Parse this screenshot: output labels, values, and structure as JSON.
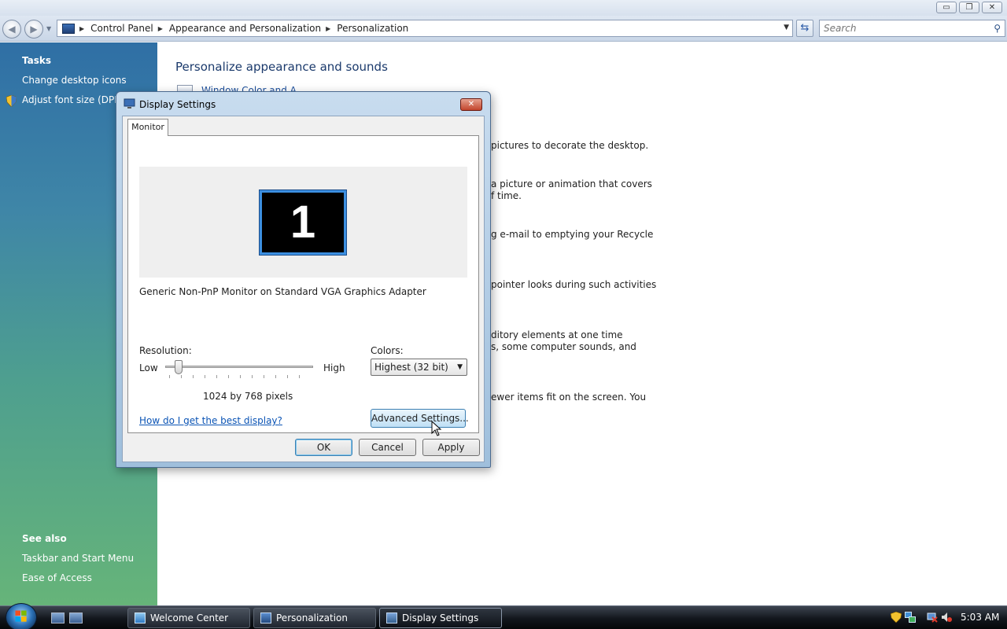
{
  "window": {
    "minimize": "▭",
    "maximize": "❐",
    "close": "✕"
  },
  "address": {
    "crumbs": [
      "Control Panel",
      "Appearance and Personalization",
      "Personalization"
    ],
    "search_placeholder": "Search"
  },
  "left_pane": {
    "tasks_heading": "Tasks",
    "tasks": [
      "Change desktop icons",
      "Adjust font size (DPI)"
    ],
    "see_also_heading": "See also",
    "see_also": [
      "Taskbar and Start Menu",
      "Ease of Access"
    ]
  },
  "main": {
    "title": "Personalize appearance and sounds",
    "partial_link": "Window Color and A",
    "partial_lines": [
      "pictures to decorate the desktop.",
      "a picture or animation that covers",
      "f time.",
      "g e-mail to emptying your Recycle",
      "pointer looks during such activities",
      "ditory elements at one time",
      "s, some computer sounds, and",
      "ewer items fit on the screen. You"
    ]
  },
  "dialog": {
    "title": "Display Settings",
    "close": "✕",
    "tab": "Monitor",
    "monitor_number": "1",
    "monitor_name": "Generic Non-PnP Monitor on Standard VGA Graphics Adapter",
    "resolution_label": "Resolution:",
    "low": "Low",
    "high": "High",
    "resolution_value": "1024 by 768 pixels",
    "resolution_level": 0.07,
    "colors_label": "Colors:",
    "colors_value": "Highest (32 bit)",
    "help_link": "How do I get the best display?",
    "advanced_button": "Advanced Settings...",
    "ok": "OK",
    "cancel": "Cancel",
    "apply": "Apply"
  },
  "taskbar": {
    "tasks": [
      "Welcome Center",
      "Personalization",
      "Display Settings"
    ],
    "active_task": "Display Settings",
    "clock": "5:03 AM"
  }
}
